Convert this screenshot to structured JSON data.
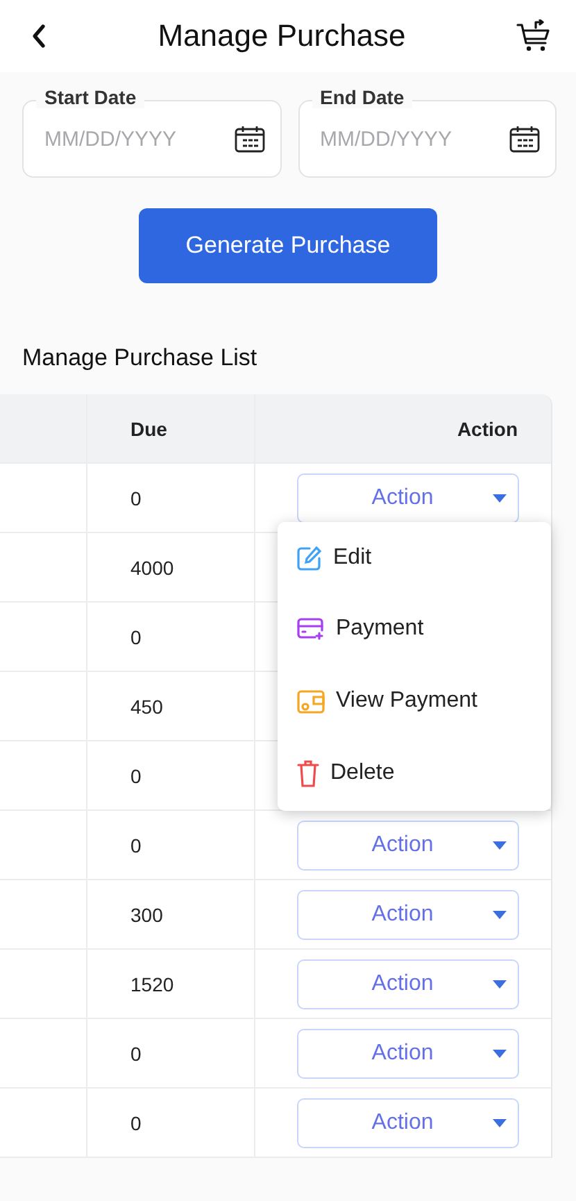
{
  "header": {
    "title": "Manage Purchase"
  },
  "date_fields": [
    {
      "label": "Start Date",
      "placeholder": "MM/DD/YYYY"
    },
    {
      "label": "End Date",
      "placeholder": "MM/DD/YYYY"
    }
  ],
  "generate_button": "Generate Purchase",
  "list_title": "Manage Purchase List",
  "table": {
    "columns": [
      "Due",
      "Action"
    ],
    "rows": [
      {
        "due": "0",
        "action": "Action"
      },
      {
        "due": "4000"
      },
      {
        "due": "0"
      },
      {
        "due": "450"
      },
      {
        "due": "0"
      },
      {
        "due": "0",
        "action": "Action"
      },
      {
        "due": "300",
        "action": "Action"
      },
      {
        "due": "1520",
        "action": "Action"
      },
      {
        "due": "0",
        "action": "Action"
      },
      {
        "due": "0",
        "action": "Action"
      }
    ]
  },
  "action_menu": {
    "items": [
      {
        "kind": "edit",
        "label": "Edit",
        "color": "#3fa2f6"
      },
      {
        "kind": "payment",
        "label": "Payment",
        "color": "#a63ff0"
      },
      {
        "kind": "view_payment",
        "label": "View Payment",
        "color": "#f5a623"
      },
      {
        "kind": "delete",
        "label": "Delete",
        "color": "#ef4b4b"
      }
    ]
  }
}
